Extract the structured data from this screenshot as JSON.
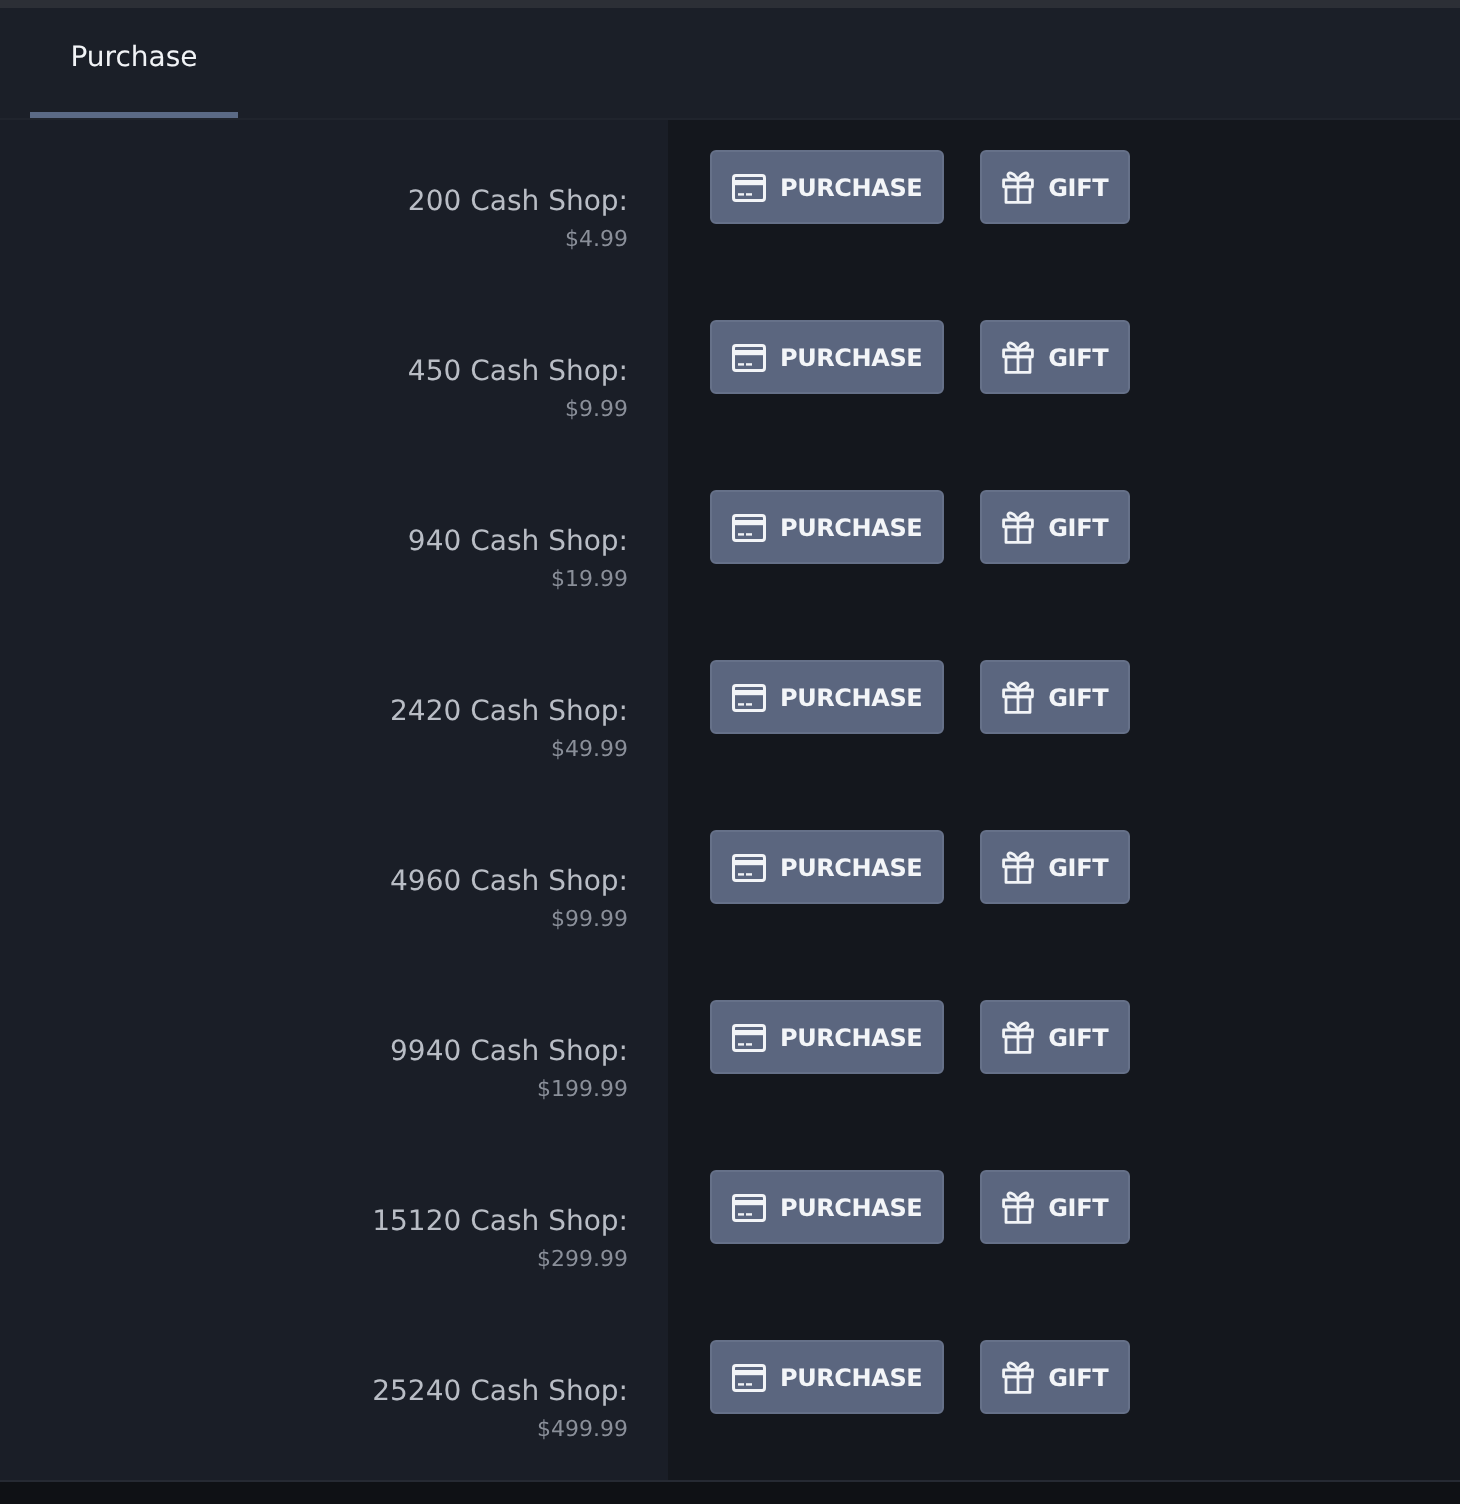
{
  "tabs": [
    {
      "label": "Purchase",
      "selected": true
    }
  ],
  "packages": [
    {
      "name": "200 Cash Shop:",
      "price": "$4.99",
      "buttons": [
        {
          "kind": "purchase",
          "label": "PURCHASE"
        },
        {
          "kind": "gift",
          "label": "GIFT"
        }
      ]
    },
    {
      "name": "450 Cash Shop:",
      "price": "$9.99",
      "buttons": [
        {
          "kind": "purchase",
          "label": "PURCHASE"
        },
        {
          "kind": "gift",
          "label": "GIFT"
        }
      ]
    },
    {
      "name": "940 Cash Shop:",
      "price": "$19.99",
      "buttons": [
        {
          "kind": "purchase",
          "label": "PURCHASE"
        },
        {
          "kind": "gift",
          "label": "GIFT"
        }
      ]
    },
    {
      "name": "2420 Cash Shop:",
      "price": "$49.99",
      "buttons": [
        {
          "kind": "purchase",
          "label": "PURCHASE"
        },
        {
          "kind": "gift",
          "label": "GIFT"
        }
      ]
    },
    {
      "name": "4960 Cash Shop:",
      "price": "$99.99",
      "buttons": [
        {
          "kind": "purchase",
          "label": "PURCHASE"
        },
        {
          "kind": "gift",
          "label": "GIFT"
        }
      ]
    },
    {
      "name": "9940 Cash Shop:",
      "price": "$199.99",
      "buttons": [
        {
          "kind": "purchase",
          "label": "PURCHASE"
        },
        {
          "kind": "gift",
          "label": "GIFT"
        }
      ]
    },
    {
      "name": "15120 Cash Shop:",
      "price": "$299.99",
      "buttons": [
        {
          "kind": "purchase",
          "label": "PURCHASE"
        },
        {
          "kind": "gift",
          "label": "GIFT"
        }
      ]
    },
    {
      "name": "25240 Cash Shop:",
      "price": "$499.99",
      "buttons": [
        {
          "kind": "purchase",
          "label": "PURCHASE"
        },
        {
          "kind": "gift",
          "label": "GIFT"
        }
      ]
    }
  ]
}
